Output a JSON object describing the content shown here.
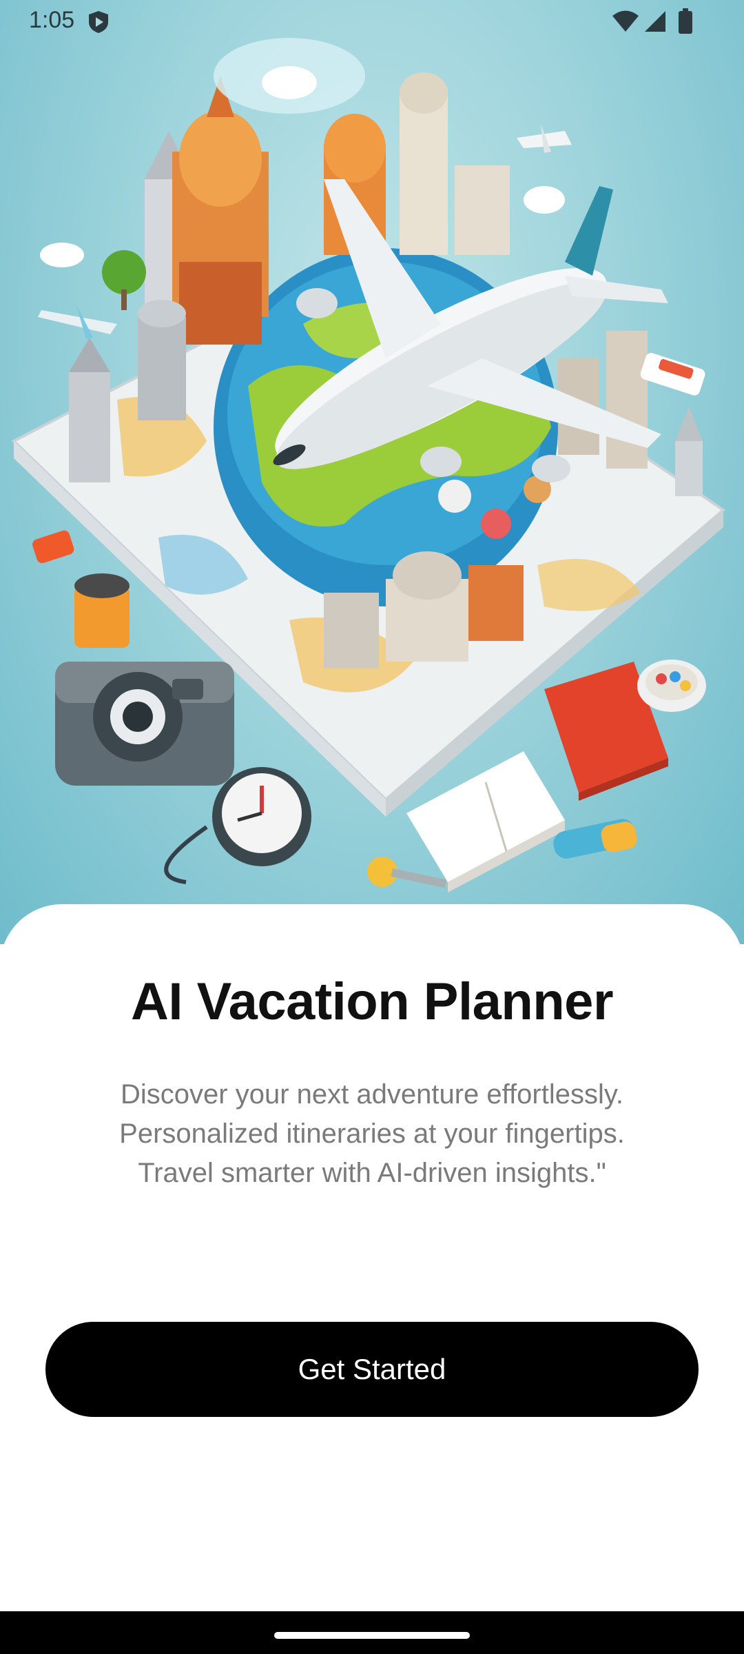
{
  "status_bar": {
    "time": "1:05"
  },
  "icons": {
    "shield": "shield-icon",
    "wifi": "wifi-icon",
    "signal": "cellular-signal-icon",
    "battery": "battery-icon"
  },
  "hero": {
    "image": "travel-illustration"
  },
  "onboarding": {
    "title": "AI Vacation Planner",
    "description_lines": [
      "Discover your next adventure effortlessly.",
      "Personalized itineraries at your fingertips.",
      "Travel smarter with AI-driven insights.\""
    ],
    "cta_label": "Get Started"
  },
  "colors": {
    "background_teal": "#9fd4dc",
    "title": "#111111",
    "subtitle": "#7a7a7a",
    "button": "#000000",
    "button_text": "#ffffff"
  }
}
